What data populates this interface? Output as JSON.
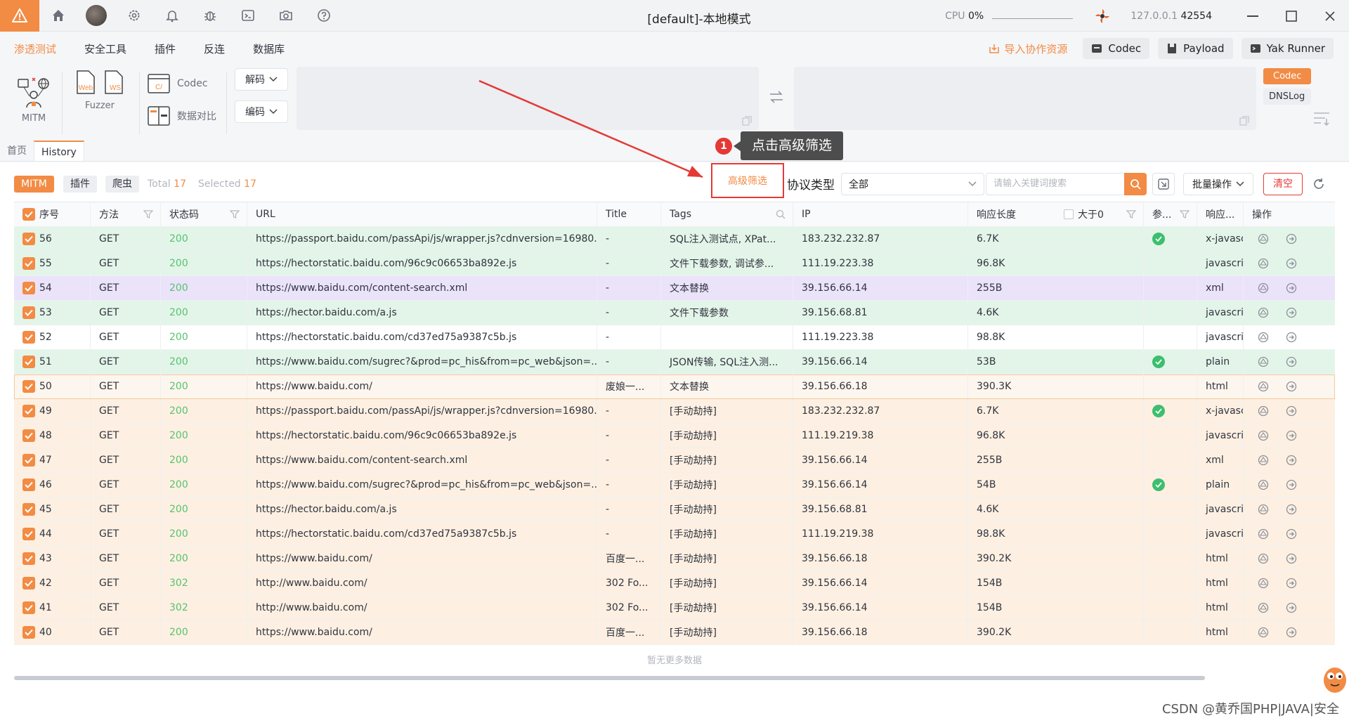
{
  "titlebar": {
    "title": "[default]-本地模式",
    "cpu_label": "CPU",
    "cpu_value": "0%",
    "ip": "127.0.0.1",
    "port": "42554"
  },
  "menu": {
    "items": [
      "渗透测试",
      "安全工具",
      "插件",
      "反连",
      "数据库"
    ],
    "import_link": "导入协作资源",
    "buttons": [
      "Codec",
      "Payload",
      "Yak Runner"
    ]
  },
  "toolbar": {
    "mitm": "MITM",
    "fuzzer": "Fuzzer",
    "web": "Web",
    "ws": "WS",
    "codec": "Codec",
    "compare": "数据对比",
    "decode": "解码",
    "encode": "编码",
    "codec_tag": "Codec",
    "dnslog_tag": "DNSLog"
  },
  "tabs": [
    "首页",
    "History"
  ],
  "filter": {
    "pills": [
      "MITM",
      "插件",
      "爬虫"
    ],
    "total_label": "Total",
    "total": "17",
    "selected_label": "Selected",
    "selected": "17",
    "advanced": "高级筛选",
    "protocol_label": "协议类型",
    "protocol_value": "全部",
    "search_placeholder": "请输入关键词搜索",
    "batch": "批量操作",
    "clear": "清空"
  },
  "annotation": {
    "number": "1",
    "text": "点击高级筛选"
  },
  "table": {
    "headers": [
      "序号",
      "方法",
      "状态码",
      "URL",
      "Title",
      "Tags",
      "IP",
      "响应长度",
      "大于0",
      "参...",
      "响应...",
      "操作"
    ],
    "rows": [
      {
        "id": "56",
        "method": "GET",
        "status": "200",
        "url": "https://passport.baidu.com/passApi/js/wrapper.js?cdnversion=16980...",
        "title": "-",
        "tags": "SQL注入测试点, XPat...",
        "ip": "183.232.232.87",
        "len": "6.7K",
        "param": true,
        "type": "x-javasc",
        "color": "green"
      },
      {
        "id": "55",
        "method": "GET",
        "status": "200",
        "url": "https://hectorstatic.baidu.com/96c9c06653ba892e.js",
        "title": "-",
        "tags": "文件下载参数, 调试参...",
        "ip": "111.19.223.38",
        "len": "96.8K",
        "param": false,
        "type": "javascrip",
        "color": "green"
      },
      {
        "id": "54",
        "method": "GET",
        "status": "200",
        "url": "https://www.baidu.com/content-search.xml",
        "title": "-",
        "tags": "文本替换",
        "ip": "39.156.66.14",
        "len": "255B",
        "param": false,
        "type": "xml",
        "color": "purple"
      },
      {
        "id": "53",
        "method": "GET",
        "status": "200",
        "url": "https://hector.baidu.com/a.js",
        "title": "-",
        "tags": "文件下载参数",
        "ip": "39.156.68.81",
        "len": "4.6K",
        "param": false,
        "type": "javascrip",
        "color": "green"
      },
      {
        "id": "52",
        "method": "GET",
        "status": "200",
        "url": "https://hectorstatic.baidu.com/cd37ed75a9387c5b.js",
        "title": "-",
        "tags": "",
        "ip": "111.19.223.38",
        "len": "98.8K",
        "param": false,
        "type": "javascrip",
        "color": "white"
      },
      {
        "id": "51",
        "method": "GET",
        "status": "200",
        "url": "https://www.baidu.com/sugrec?&prod=pc_his&from=pc_web&json=...",
        "title": "-",
        "tags": "JSON传输, SQL注入测...",
        "ip": "39.156.66.14",
        "len": "53B",
        "param": true,
        "type": "plain",
        "color": "green"
      },
      {
        "id": "50",
        "method": "GET",
        "status": "200",
        "url": "https://www.baidu.com/",
        "title": "废娘一...",
        "tags": "文本替换",
        "ip": "39.156.66.18",
        "len": "390.3K",
        "param": false,
        "type": "html",
        "color": "sel"
      },
      {
        "id": "49",
        "method": "GET",
        "status": "200",
        "url": "https://passport.baidu.com/passApi/js/wrapper.js?cdnversion=16980...",
        "title": "-",
        "tags": "[手动劫持]",
        "ip": "183.232.232.87",
        "len": "6.7K",
        "param": true,
        "type": "x-javasc",
        "color": "peach"
      },
      {
        "id": "48",
        "method": "GET",
        "status": "200",
        "url": "https://hectorstatic.baidu.com/96c9c06653ba892e.js",
        "title": "-",
        "tags": "[手动劫持]",
        "ip": "111.19.219.38",
        "len": "96.8K",
        "param": false,
        "type": "javascrip",
        "color": "peach"
      },
      {
        "id": "47",
        "method": "GET",
        "status": "200",
        "url": "https://www.baidu.com/content-search.xml",
        "title": "-",
        "tags": "[手动劫持]",
        "ip": "39.156.66.14",
        "len": "255B",
        "param": false,
        "type": "xml",
        "color": "peach"
      },
      {
        "id": "46",
        "method": "GET",
        "status": "200",
        "url": "https://www.baidu.com/sugrec?&prod=pc_his&from=pc_web&json=...",
        "title": "-",
        "tags": "[手动劫持]",
        "ip": "39.156.66.14",
        "len": "54B",
        "param": true,
        "type": "plain",
        "color": "peach"
      },
      {
        "id": "45",
        "method": "GET",
        "status": "200",
        "url": "https://hector.baidu.com/a.js",
        "title": "-",
        "tags": "[手动劫持]",
        "ip": "39.156.68.81",
        "len": "4.6K",
        "param": false,
        "type": "javascrip",
        "color": "peach"
      },
      {
        "id": "44",
        "method": "GET",
        "status": "200",
        "url": "https://hectorstatic.baidu.com/cd37ed75a9387c5b.js",
        "title": "-",
        "tags": "[手动劫持]",
        "ip": "111.19.219.38",
        "len": "98.8K",
        "param": false,
        "type": "javascrip",
        "color": "peach"
      },
      {
        "id": "43",
        "method": "GET",
        "status": "200",
        "url": "https://www.baidu.com/",
        "title": "百度一...",
        "tags": "[手动劫持]",
        "ip": "39.156.66.18",
        "len": "390.2K",
        "param": false,
        "type": "html",
        "color": "peach"
      },
      {
        "id": "42",
        "method": "GET",
        "status": "302",
        "url": "http://www.baidu.com/",
        "title": "302 Fo...",
        "tags": "[手动劫持]",
        "ip": "39.156.66.14",
        "len": "154B",
        "param": false,
        "type": "html",
        "color": "peach"
      },
      {
        "id": "41",
        "method": "GET",
        "status": "302",
        "url": "http://www.baidu.com/",
        "title": "302 Fo...",
        "tags": "[手动劫持]",
        "ip": "39.156.66.14",
        "len": "154B",
        "param": false,
        "type": "html",
        "color": "peach"
      },
      {
        "id": "40",
        "method": "GET",
        "status": "200",
        "url": "https://www.baidu.com/",
        "title": "百度一...",
        "tags": "[手动劫持]",
        "ip": "39.156.66.18",
        "len": "390.2K",
        "param": false,
        "type": "html",
        "color": "peach"
      }
    ],
    "empty_text": "暂无更多数据"
  },
  "watermark": "CSDN @黄乔国PHP|JAVA|安全"
}
